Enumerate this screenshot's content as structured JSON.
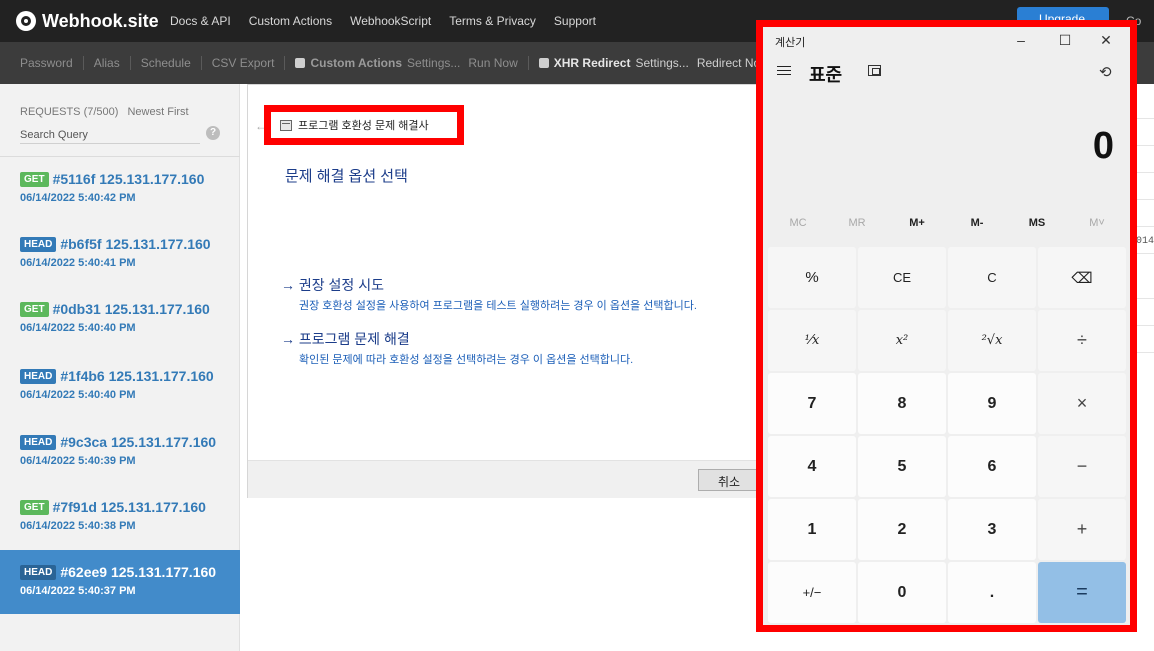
{
  "navbar": {
    "brand": "Webhook.site",
    "links": [
      "Docs & API",
      "Custom Actions",
      "WebhookScript",
      "Terms & Privacy",
      "Support"
    ],
    "upgrade_label": "Upgrade",
    "copy_label": "Co"
  },
  "toolbar": {
    "password": "Password",
    "alias": "Alias",
    "schedule": "Schedule",
    "csv_export": "CSV Export",
    "custom_actions": "Custom Actions",
    "settings_1": "Settings...",
    "run_now": "Run Now",
    "xhr_redirect": "XHR Redirect",
    "settings_2": "Settings...",
    "redirect_now": "Redirect Now"
  },
  "sidebar": {
    "requests_label": "REQUESTS (7/500)",
    "sort_label": "Newest First",
    "search_placeholder": "Search Query",
    "help": "?",
    "requests": [
      {
        "method": "GET",
        "title": "#5116f 125.131.177.160",
        "date": "06/14/2022 5:40:42 PM"
      },
      {
        "method": "HEAD",
        "title": "#b6f5f 125.131.177.160",
        "date": "06/14/2022 5:40:41 PM"
      },
      {
        "method": "GET",
        "title": "#0db31 125.131.177.160",
        "date": "06/14/2022 5:40:40 PM"
      },
      {
        "method": "HEAD",
        "title": "#1f4b6 125.131.177.160",
        "date": "06/14/2022 5:40:40 PM"
      },
      {
        "method": "HEAD",
        "title": "#9c3ca 125.131.177.160",
        "date": "06/14/2022 5:40:39 PM"
      },
      {
        "method": "GET",
        "title": "#7f91d 125.131.177.160",
        "date": "06/14/2022 5:40:38 PM"
      },
      {
        "method": "HEAD",
        "title": "#62ee9 125.131.177.160",
        "date": "06/14/2022 5:40:37 PM"
      }
    ]
  },
  "dialog": {
    "title": "프로그램 호환성 문제 해결사",
    "heading": "문제 해결 옵션 선택",
    "option1_title": "→ 권장 설정 시도",
    "option1_desc": "권장 호환성 설정을 사용하여 프로그램을 테스트 실행하려는 경우 이 옵션을 선택합니다.",
    "option2_title": "→ 프로그램 문제 해결",
    "option2_desc": "확인된 문제에 따라 호환성 설정을 선택하려는 경우 이 옵션을 선택합니다.",
    "cancel_label": "취소"
  },
  "background": {
    "detail_text": "014"
  },
  "calculator": {
    "app_title": "계산기",
    "mode": "표준",
    "display": "0",
    "memory": [
      "MC",
      "MR",
      "M+",
      "M-",
      "MS",
      "M˅"
    ],
    "keys": [
      [
        "%",
        "CE",
        "C",
        "⌫"
      ],
      [
        "¹⁄x",
        "x²",
        "²√x",
        "÷"
      ],
      [
        "7",
        "8",
        "9",
        "×"
      ],
      [
        "4",
        "5",
        "6",
        "−"
      ],
      [
        "1",
        "2",
        "3",
        "+"
      ],
      [
        "+/−",
        "0",
        ".",
        "="
      ]
    ]
  },
  "colors": {
    "accent_blue": "#337ab7",
    "get_badge": "#5cb85c",
    "highlight_frame": "#ff0000",
    "equals_key": "#93bfe6"
  }
}
